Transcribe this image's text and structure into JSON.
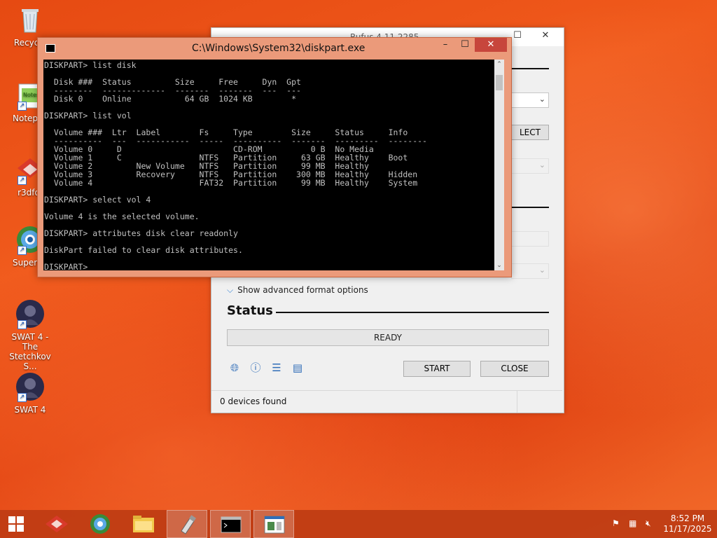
{
  "desktop": {
    "icons": [
      {
        "label": "Recycle"
      },
      {
        "label": "Notepac"
      },
      {
        "label": "r3dfo:"
      },
      {
        "label": "Supermi"
      },
      {
        "label": "SWAT 4 - The Stetchkov S..."
      },
      {
        "label": "SWAT 4"
      }
    ]
  },
  "rufus": {
    "title": "Rufus 4.11.2285",
    "select_button": "LECT",
    "advanced_toggle": "Show advanced format options",
    "status_heading": "Status",
    "progress_text": "READY",
    "start_label": "START",
    "close_label": "CLOSE",
    "status_bar": "0 devices found"
  },
  "cmd": {
    "title": "C:\\Windows\\System32\\diskpart.exe",
    "lines": [
      "DISKPART> list disk",
      "",
      "  Disk ###  Status         Size     Free     Dyn  Gpt",
      "  --------  -------------  -------  -------  ---  ---",
      "  Disk 0    Online           64 GB  1024 KB        *",
      "",
      "DISKPART> list vol",
      "",
      "  Volume ###  Ltr  Label        Fs     Type        Size     Status     Info",
      "  ----------  ---  -----------  -----  ----------  -------  ---------  --------",
      "  Volume 0     D                       CD-ROM          0 B  No Media",
      "  Volume 1     C                NTFS   Partition     63 GB  Healthy    Boot",
      "  Volume 2         New Volume   NTFS   Partition     99 MB  Healthy",
      "  Volume 3         Recovery     NTFS   Partition    300 MB  Healthy    Hidden",
      "  Volume 4                      FAT32  Partition     99 MB  Healthy    System",
      "",
      "DISKPART> select vol 4",
      "",
      "Volume 4 is the selected volume.",
      "",
      "DISKPART> attributes disk clear readonly",
      "",
      "DiskPart failed to clear disk attributes.",
      "",
      "DISKPART> "
    ]
  },
  "taskbar": {
    "time": "8:52 PM",
    "date": "11/17/2025"
  }
}
